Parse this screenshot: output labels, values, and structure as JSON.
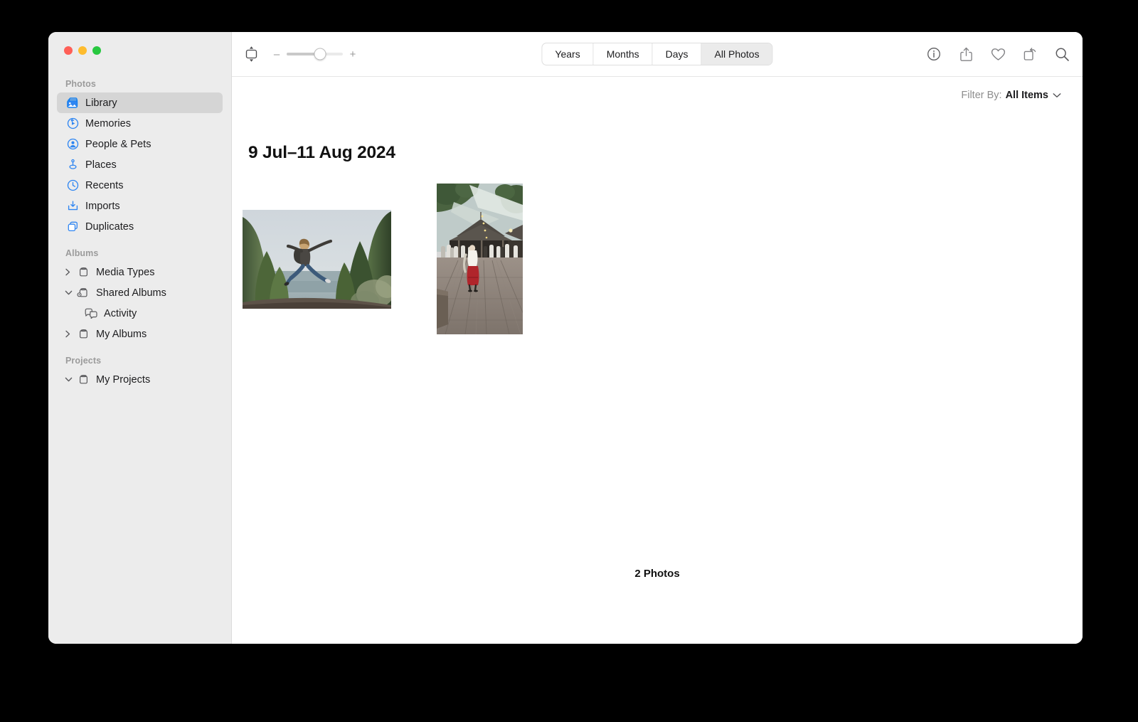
{
  "window": {
    "traffic_lights": [
      {
        "name": "close",
        "color": "#ff5f57"
      },
      {
        "name": "minimize",
        "color": "#febc2e"
      },
      {
        "name": "zoom",
        "color": "#28c840"
      }
    ]
  },
  "sidebar": {
    "sections": [
      {
        "title": "Photos",
        "items": [
          {
            "label": "Library",
            "icon": "library-icon",
            "selected": true,
            "twisty": "",
            "indent": false
          },
          {
            "label": "Memories",
            "icon": "memories-icon",
            "selected": false,
            "twisty": "",
            "indent": false
          },
          {
            "label": "People & Pets",
            "icon": "people-pets-icon",
            "selected": false,
            "twisty": "",
            "indent": false
          },
          {
            "label": "Places",
            "icon": "places-icon",
            "selected": false,
            "twisty": "",
            "indent": false
          },
          {
            "label": "Recents",
            "icon": "recents-icon",
            "selected": false,
            "twisty": "",
            "indent": false
          },
          {
            "label": "Imports",
            "icon": "imports-icon",
            "selected": false,
            "twisty": "",
            "indent": false
          },
          {
            "label": "Duplicates",
            "icon": "duplicates-icon",
            "selected": false,
            "twisty": "",
            "indent": false
          }
        ]
      },
      {
        "title": "Albums",
        "items": [
          {
            "label": "Media Types",
            "icon": "album-folder-icon",
            "selected": false,
            "twisty": "right",
            "indent": false
          },
          {
            "label": "Shared Albums",
            "icon": "shared-album-icon",
            "selected": false,
            "twisty": "down",
            "indent": false
          },
          {
            "label": "Activity",
            "icon": "activity-icon",
            "selected": false,
            "twisty": "",
            "indent": true
          },
          {
            "label": "My Albums",
            "icon": "album-folder-icon",
            "selected": false,
            "twisty": "right",
            "indent": false
          }
        ]
      },
      {
        "title": "Projects",
        "items": [
          {
            "label": "My Projects",
            "icon": "album-folder-icon",
            "selected": false,
            "twisty": "down",
            "indent": false
          }
        ]
      }
    ]
  },
  "toolbar": {
    "aspect_button_name": "aspect-ratio-button",
    "zoom_out_label": "–",
    "zoom_in_label": "+",
    "zoom_value_percent": 60,
    "segments": [
      {
        "label": "Years",
        "active": false
      },
      {
        "label": "Months",
        "active": false
      },
      {
        "label": "Days",
        "active": false
      },
      {
        "label": "All Photos",
        "active": true
      }
    ],
    "right_icons": [
      {
        "name": "info-icon"
      },
      {
        "name": "share-icon"
      },
      {
        "name": "favorite-heart-icon"
      },
      {
        "name": "rotate-icon"
      },
      {
        "name": "search-icon"
      }
    ]
  },
  "content": {
    "filter_label": "Filter By:",
    "filter_value": "All Items",
    "date_heading": "9 Jul–11 Aug 2024",
    "photo_count": "2 Photos",
    "photos": [
      {
        "name": "photo-thumbnail-jumping-person",
        "description": "Person jumping with backpack in front of lake framed by evergreen trees",
        "orientation": "landscape"
      },
      {
        "name": "photo-thumbnail-wooden-deck-pavilion",
        "description": "Outdoor wooden deck with pavilion, people and a person in red traditional dress",
        "orientation": "portrait"
      }
    ]
  }
}
